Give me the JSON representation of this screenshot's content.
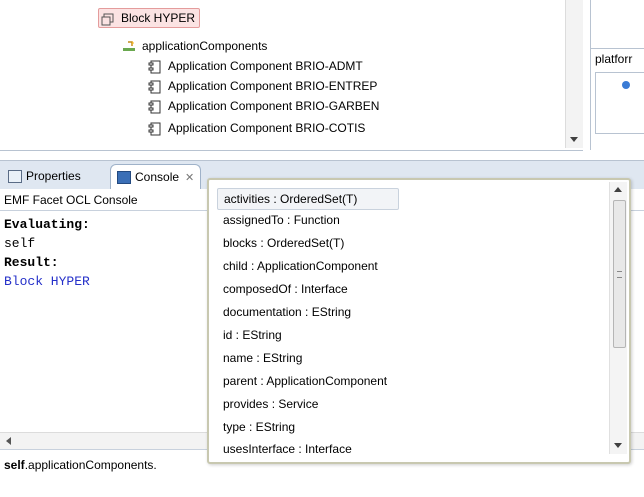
{
  "tree": {
    "selected_item": "Block HYPER",
    "group_label": "applicationComponents",
    "components": [
      "Application Component BRIO-ADMT",
      "Application Component BRIO-ENTREP",
      "Application Component BRIO-GARBEN",
      "Application Component BRIO-COTIS"
    ]
  },
  "right_pane": {
    "label": "platforr"
  },
  "tabs": {
    "properties": "Properties",
    "console": "Console",
    "close": "✕"
  },
  "console": {
    "title": "EMF Facet OCL Console",
    "output": {
      "line1": "Evaluating:",
      "line2": "self",
      "line3": "Result:",
      "line4": "Block HYPER"
    },
    "input_bold": "self",
    "input_rest": ".applicationComponents."
  },
  "completion": {
    "options": [
      "activities : OrderedSet(T)",
      "assignedTo : Function",
      "blocks : OrderedSet(T)",
      "child : ApplicationComponent",
      "composedOf : Interface",
      "documentation : EString",
      "id : EString",
      "name : EString",
      "parent : ApplicationComponent",
      "provides : Service",
      "type : EString",
      "usesInterface : Interface"
    ]
  },
  "colors": {
    "result_blue": "#2530c9",
    "selection_pink": "#fbe3e3"
  }
}
